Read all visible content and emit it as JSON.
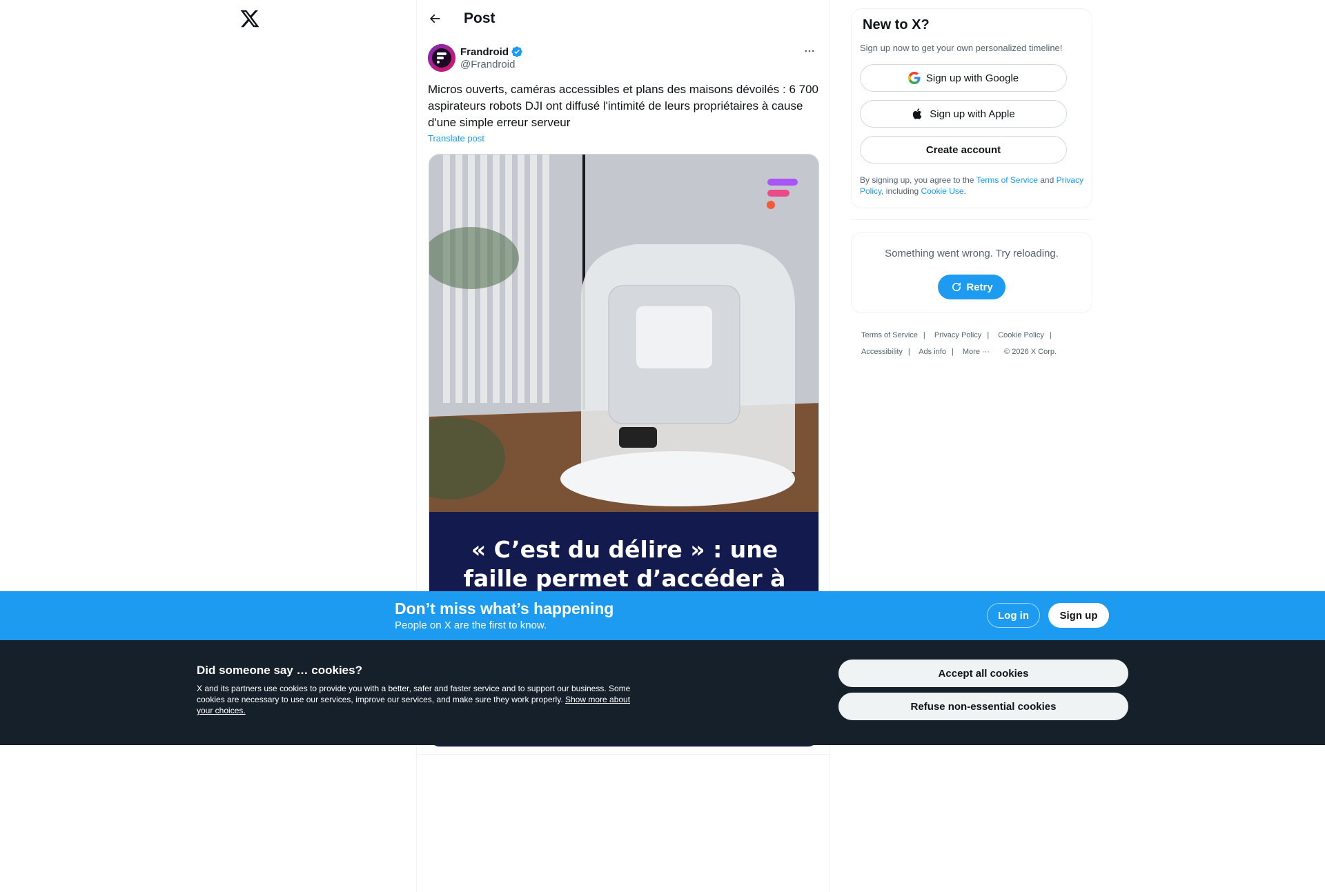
{
  "header": {
    "back_icon": "arrow-left-icon",
    "title": "Post",
    "logo_icon": "x-logo-icon"
  },
  "post": {
    "author_name": "Frandroid",
    "author_handle": "@Frandroid",
    "verified_icon": "verified-badge-icon",
    "more_icon": "more-dots-icon",
    "text": "Micros ouverts, caméras accessibles et plans des maisons dévoilés : 6 700 aspirateurs robots DJI ont diffusé l'intimité de leurs propriétaires à cause d'une simple erreur serveur",
    "translate_label": "Translate post",
    "media_headline": "« C’est du délire » : une faille permet d’accéder à tous les"
  },
  "signup": {
    "title": "New to X?",
    "subtitle": "Sign up now to get your own personalized timeline!",
    "google_label": "Sign up with Google",
    "apple_label": "Sign up with Apple",
    "create_label": "Create account",
    "legal_prefix": "By signing up, you agree to the ",
    "terms_label": "Terms of Service",
    "legal_and": " and ",
    "privacy_label": "Privacy Policy",
    "legal_including": ", including ",
    "cookie_label": "Cookie Use",
    "legal_end": "."
  },
  "error_panel": {
    "message": "Something went wrong. Try reloading.",
    "retry_label": "Retry"
  },
  "footer": {
    "links": [
      "Terms of Service",
      "Privacy Policy",
      "Cookie Policy",
      "Accessibility",
      "Ads info",
      "More ···",
      "© 2026 X Corp."
    ]
  },
  "bottom_bar": {
    "title": "Don’t miss what’s happening",
    "subtitle": "People on X are the first to know.",
    "login_label": "Log in",
    "signup_label": "Sign up"
  },
  "cookie_banner": {
    "title": "Did someone say … cookies?",
    "body": "X and its partners use cookies to provide you with a better, safer and faster service and to support our business. Some cookies are necessary to use our services, improve our services, and make sure they work properly. ",
    "link_label": "Show more about your choices.",
    "accept_label": "Accept all cookies",
    "refuse_label": "Refuse non-essential cookies"
  },
  "colors": {
    "accent": "#1d9bf0",
    "cookie_bg": "#16202a",
    "media_panel": "#121a4e"
  }
}
